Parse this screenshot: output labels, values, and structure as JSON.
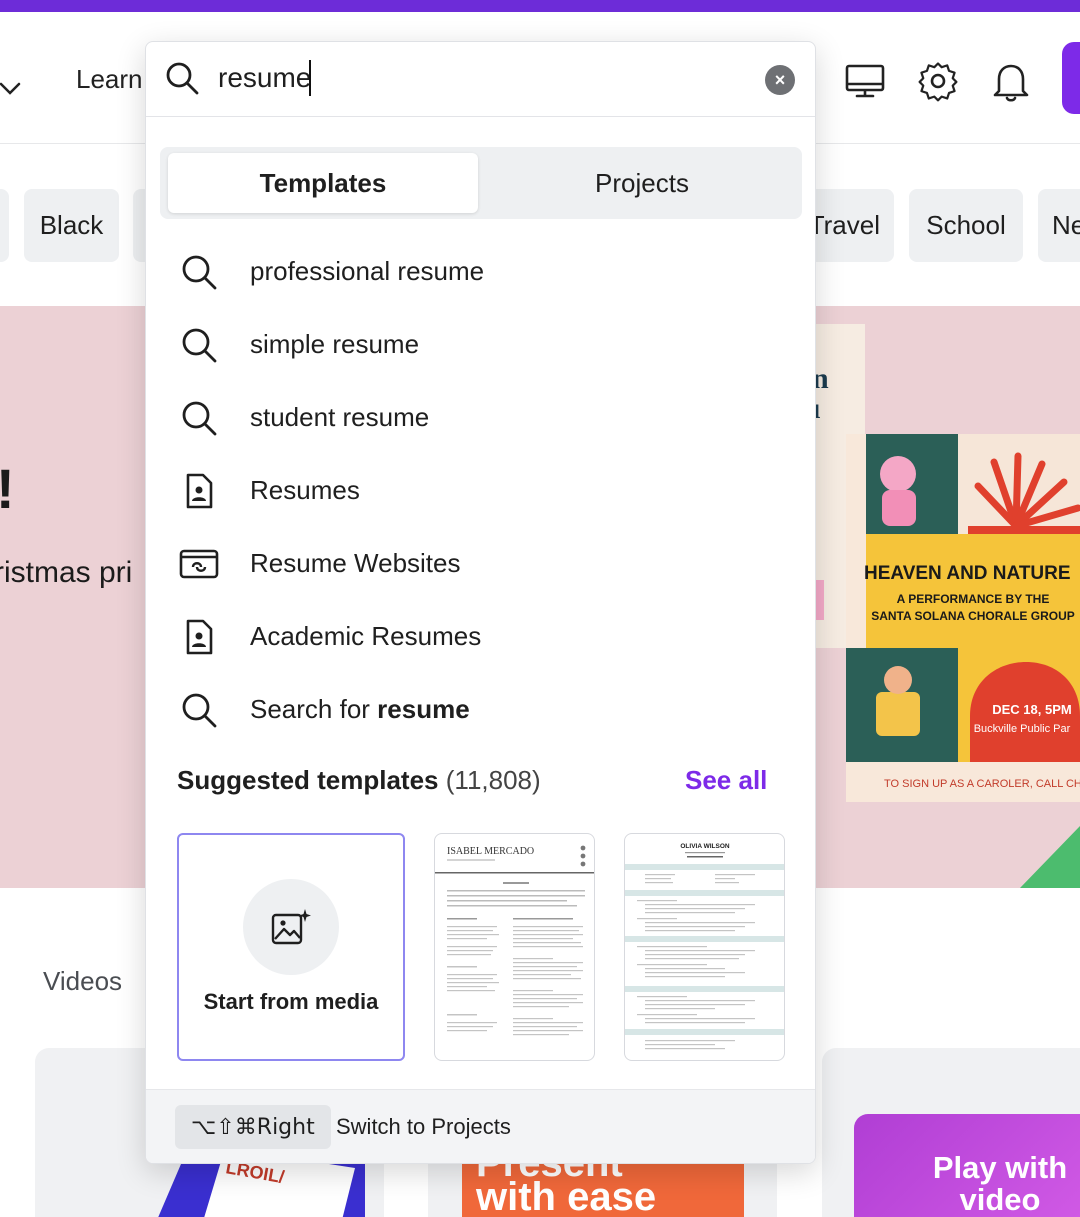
{
  "header": {
    "learn_label": "Learn",
    "icons": [
      "desktop-icon",
      "gear-icon",
      "bell-icon"
    ]
  },
  "chips": [
    "Black",
    "Travel",
    "School",
    "Ne"
  ],
  "hero": {
    "exclaim": "!",
    "subtitle": "ristmas pri",
    "poster": {
      "title": "HEAVEN AND NATURE",
      "line1": "A PERFORMANCE BY THE",
      "line2": "SANTA SOLANA CHORALE GROUP",
      "date": "DEC 18, 5PM",
      "venue": "Buckville Public Par",
      "footer": "TO SIGN UP AS A CAROLER, CALL CHIDI E"
    }
  },
  "sections": {
    "videos_label": "Videos",
    "present_text_1": "Present",
    "present_text_2": "with ease",
    "play_text_1": "Play with",
    "play_text_2": "video"
  },
  "search": {
    "value": "resume",
    "tabs": [
      "Templates",
      "Projects"
    ],
    "suggestions": [
      {
        "icon": "search-icon",
        "label": "professional resume"
      },
      {
        "icon": "search-icon",
        "label": "simple resume"
      },
      {
        "icon": "search-icon",
        "label": "student resume"
      },
      {
        "icon": "document-person-icon",
        "label": "Resumes"
      },
      {
        "icon": "website-icon",
        "label": "Resume Websites"
      },
      {
        "icon": "document-person-icon",
        "label": "Academic Resumes"
      }
    ],
    "search_for_prefix": "Search for ",
    "search_for_term": "resume",
    "suggested_heading": "Suggested templates",
    "suggested_count": "(11,808)",
    "see_all": "See all",
    "start_from_media": "Start from media",
    "template_names": [
      "ISABEL MERCADO",
      "OLIVIA WILSON"
    ],
    "shortcut": "⌥⇧⌘Right",
    "shortcut_action": "Switch to Projects"
  }
}
